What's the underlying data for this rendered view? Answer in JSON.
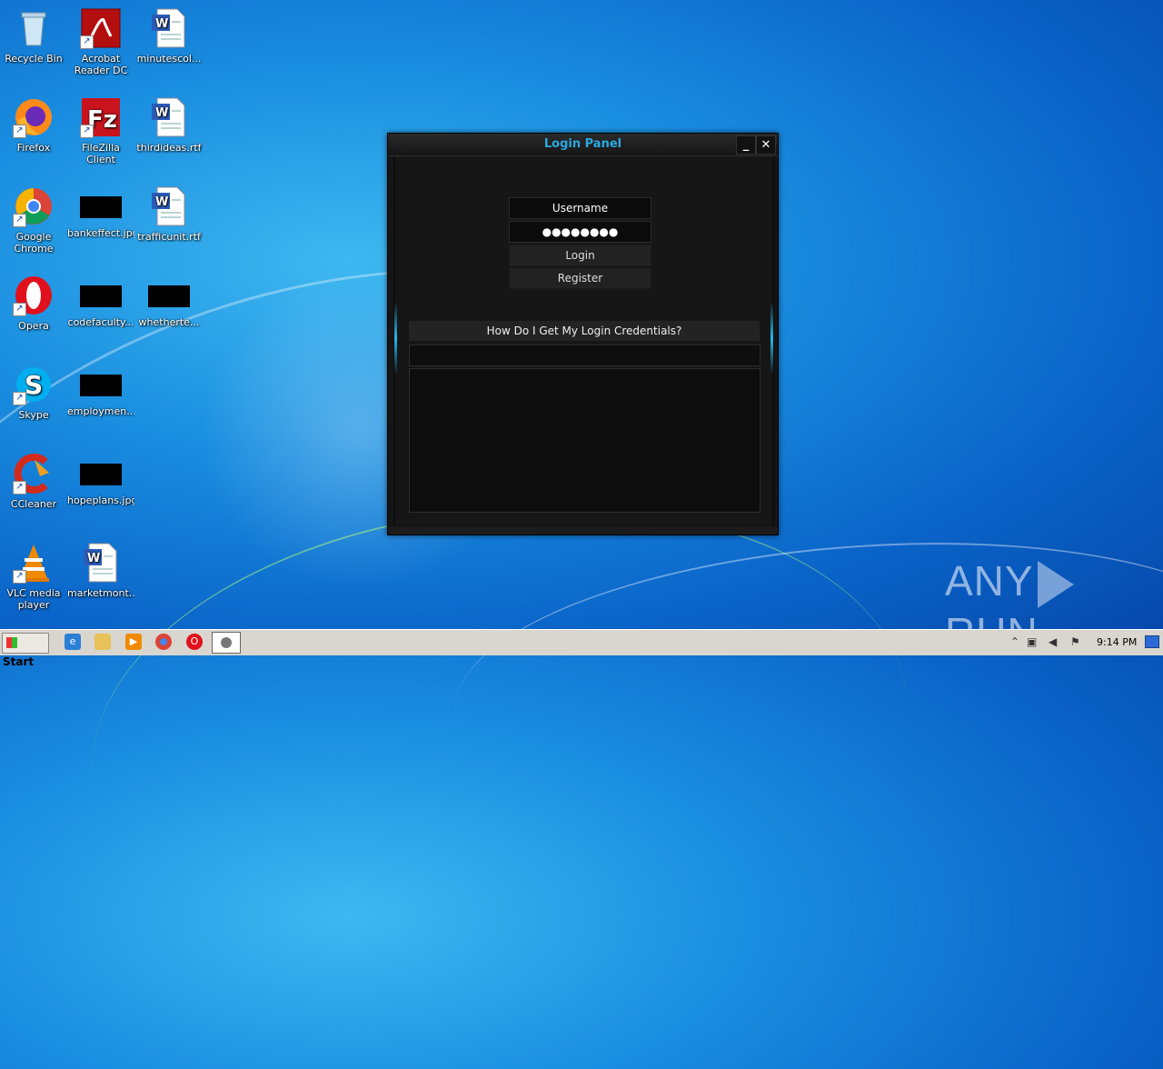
{
  "desktop": {
    "icons": [
      {
        "label": "Recycle Bin",
        "icon": "recycle-bin-icon"
      },
      {
        "label": "Acrobat Reader DC",
        "icon": "acrobat-icon"
      },
      {
        "label": "minutescol...",
        "icon": "word-doc-icon"
      },
      {
        "label": "Firefox",
        "icon": "firefox-icon"
      },
      {
        "label": "FileZilla Client",
        "icon": "filezilla-icon"
      },
      {
        "label": "thirdideas.rtf",
        "icon": "word-doc-icon"
      },
      {
        "label": "Google Chrome",
        "icon": "chrome-icon"
      },
      {
        "label": "bankeffect.jpg",
        "icon": "image-thumbnail-icon"
      },
      {
        "label": "trafficunit.rtf",
        "icon": "word-doc-icon"
      },
      {
        "label": "Opera",
        "icon": "opera-icon"
      },
      {
        "label": "codefaculty...",
        "icon": "image-thumbnail-icon"
      },
      {
        "label": "whetherte...",
        "icon": "image-thumbnail-icon"
      },
      {
        "label": "Skype",
        "icon": "skype-icon"
      },
      {
        "label": "employmen...",
        "icon": "image-thumbnail-icon"
      },
      {
        "label": "CCleaner",
        "icon": "ccleaner-icon"
      },
      {
        "label": "hopeplans.jpg",
        "icon": "image-thumbnail-icon"
      },
      {
        "label": "VLC media player",
        "icon": "vlc-icon"
      },
      {
        "label": "marketmont...",
        "icon": "word-doc-icon"
      }
    ]
  },
  "window": {
    "title": "Login Panel",
    "minimize_glyph": "_",
    "close_glyph": "✕",
    "username_value": "Username",
    "password_value": "●●●●●●●●",
    "login_label": "Login",
    "register_label": "Register",
    "help_label": "How Do I Get My Login Credentials?"
  },
  "watermark": {
    "left": "ANY",
    "right": "RUN"
  },
  "taskbar": {
    "start_label": "Start",
    "clock": "9:14 PM",
    "colors": {
      "accent": "#2aa9e0"
    }
  }
}
